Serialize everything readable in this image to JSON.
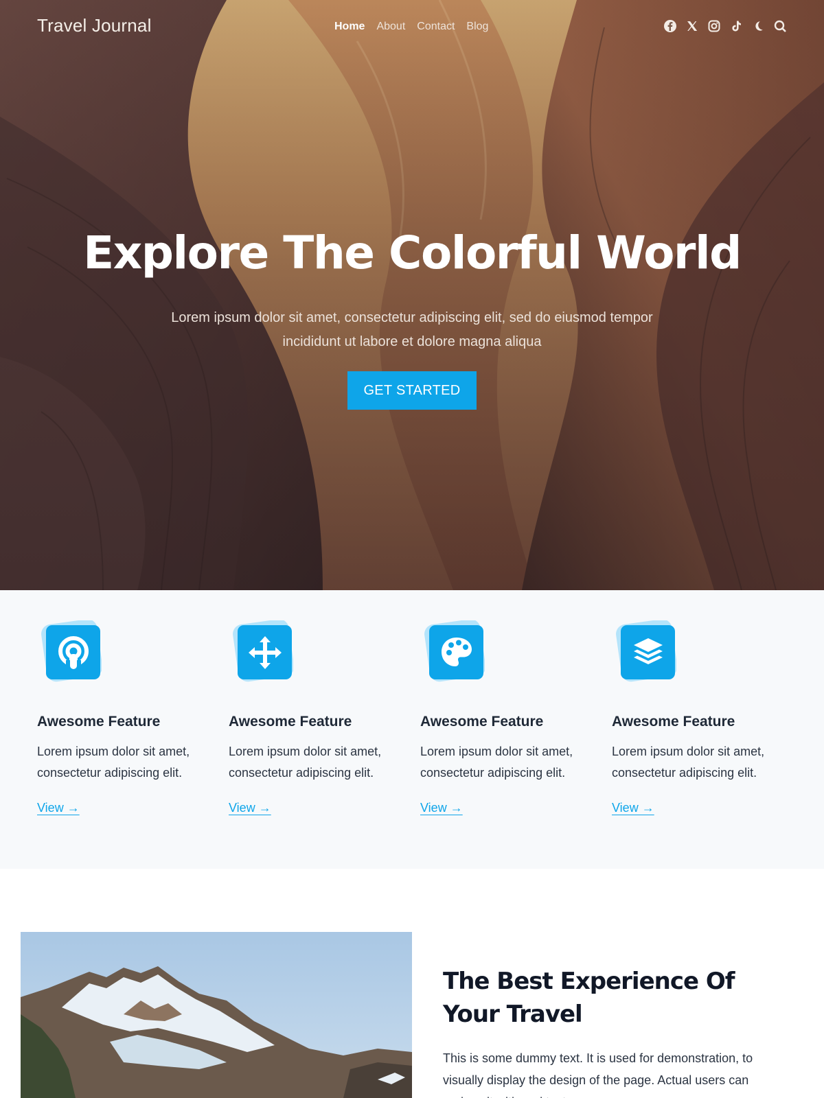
{
  "header": {
    "brand": "Travel Journal",
    "nav": [
      {
        "label": "Home",
        "active": true
      },
      {
        "label": "About",
        "active": false
      },
      {
        "label": "Contact",
        "active": false
      },
      {
        "label": "Blog",
        "active": false
      }
    ],
    "icons": [
      "facebook-icon",
      "x-icon",
      "instagram-icon",
      "tiktok-icon",
      "moon-icon",
      "search-icon"
    ]
  },
  "hero": {
    "title": "Explore The Colorful World",
    "subtitle": "Lorem ipsum dolor sit amet, consectetur adipiscing elit, sed do eiusmod tempor incididunt ut labore et dolore magna aliqua",
    "cta": "GET STARTED"
  },
  "features": [
    {
      "icon": "podcast-icon",
      "title": "Awesome Feature",
      "text": "Lorem ipsum dolor sit amet, consectetur adipiscing elit.",
      "link": "View →"
    },
    {
      "icon": "move-arrows-icon",
      "title": "Awesome Feature",
      "text": "Lorem ipsum dolor sit amet, consectetur adipiscing elit.",
      "link": "View →"
    },
    {
      "icon": "palette-icon",
      "title": "Awesome Feature",
      "text": "Lorem ipsum dolor sit amet, consectetur adipiscing elit.",
      "link": "View →"
    },
    {
      "icon": "layers-icon",
      "title": "Awesome Feature",
      "text": "Lorem ipsum dolor sit amet, consectetur adipiscing elit.",
      "link": "View →"
    }
  ],
  "experience": {
    "title": "The Best Experience Of Your Travel",
    "text": "This is some dummy text. It is used for demonstration, to visually display the design of the page. Actual users can replace it with real text."
  },
  "colors": {
    "accent": "#0ea5e9",
    "feature_bg": "#f7f9fb",
    "heading": "#111827"
  }
}
